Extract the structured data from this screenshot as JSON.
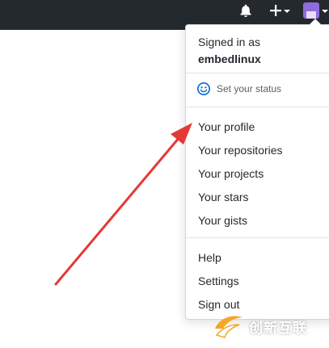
{
  "header": {
    "icons": [
      "bell-icon",
      "plus-icon",
      "avatar"
    ],
    "background": "#24292e"
  },
  "user_menu": {
    "signed_in_label": "Signed in as",
    "username": "embedlinux",
    "set_status_label": "Set your status",
    "items": [
      "Your profile",
      "Your repositories",
      "Your projects",
      "Your stars",
      "Your gists",
      "Help",
      "Settings",
      "Sign out"
    ]
  },
  "annotation": {
    "arrow_color": "#e53935"
  },
  "watermark": {
    "text": "创新互联"
  }
}
